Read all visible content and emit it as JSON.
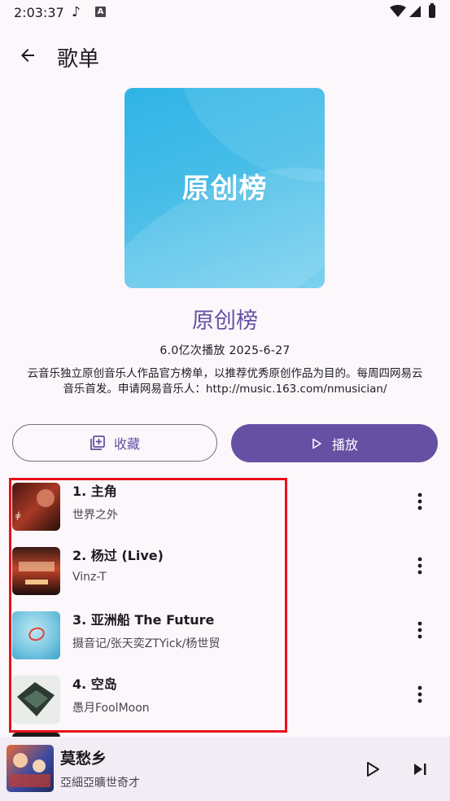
{
  "status_bar": {
    "time": "2:03:37",
    "a_badge": "A"
  },
  "app_bar": {
    "title": "歌单",
    "back_icon": "arrow-left-icon"
  },
  "playlist": {
    "cover_text": "原创榜",
    "name": "原创榜",
    "stats": "6.0亿次播放 2025-6-27",
    "description": "云音乐独立原创音乐人作品官方榜单，以推荐优秀原创作品为目的。每周四网易云音乐首发。申请网易音乐人：http://music.163.com/nmusician/"
  },
  "actions": {
    "collect_label": "收藏",
    "play_label": "播放"
  },
  "songs": [
    {
      "title": "1. 主角",
      "artist": "世界之外"
    },
    {
      "title": "2. 杨过 (Live)",
      "artist": "Vinz-T"
    },
    {
      "title": "3. 亚洲船 The Future",
      "artist": "摄音记/张天奕ZTYick/杨世贸"
    },
    {
      "title": "4. 空岛",
      "artist": "愚月FoolMoon"
    }
  ],
  "now_playing": {
    "title": "莫愁乡",
    "artist": "亞細亞曠世奇才"
  },
  "colors": {
    "accent": "#6650a4",
    "highlight": "#e8111b",
    "background": "#fcf7fb"
  }
}
